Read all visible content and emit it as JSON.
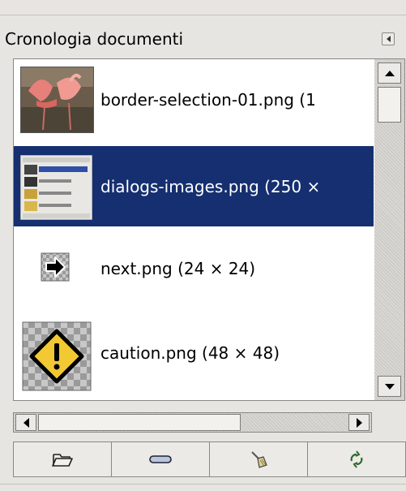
{
  "panel": {
    "title": "Cronologia documenti"
  },
  "items": [
    {
      "label": "border-selection-01.png (1",
      "thumbnail_icon": "flamingo-photo-thumbnail",
      "selected": false
    },
    {
      "label": "dialogs-images.png (250 ×",
      "thumbnail_icon": "dialog-screenshot-thumbnail",
      "selected": true
    },
    {
      "label": "next.png (24 × 24)",
      "thumbnail_icon": "next-arrow-thumbnail",
      "selected": false
    },
    {
      "label": "caution.png (48 × 48)",
      "thumbnail_icon": "caution-sign-thumbnail",
      "selected": false
    }
  ],
  "toolbar": {
    "buttons": [
      {
        "icon": "open-folder-icon"
      },
      {
        "icon": "remove-icon"
      },
      {
        "icon": "clear-history-broom-icon"
      },
      {
        "icon": "refresh-icon"
      }
    ]
  },
  "colors": {
    "selection": "#152f70",
    "panel_bg": "#e7e5e1"
  }
}
